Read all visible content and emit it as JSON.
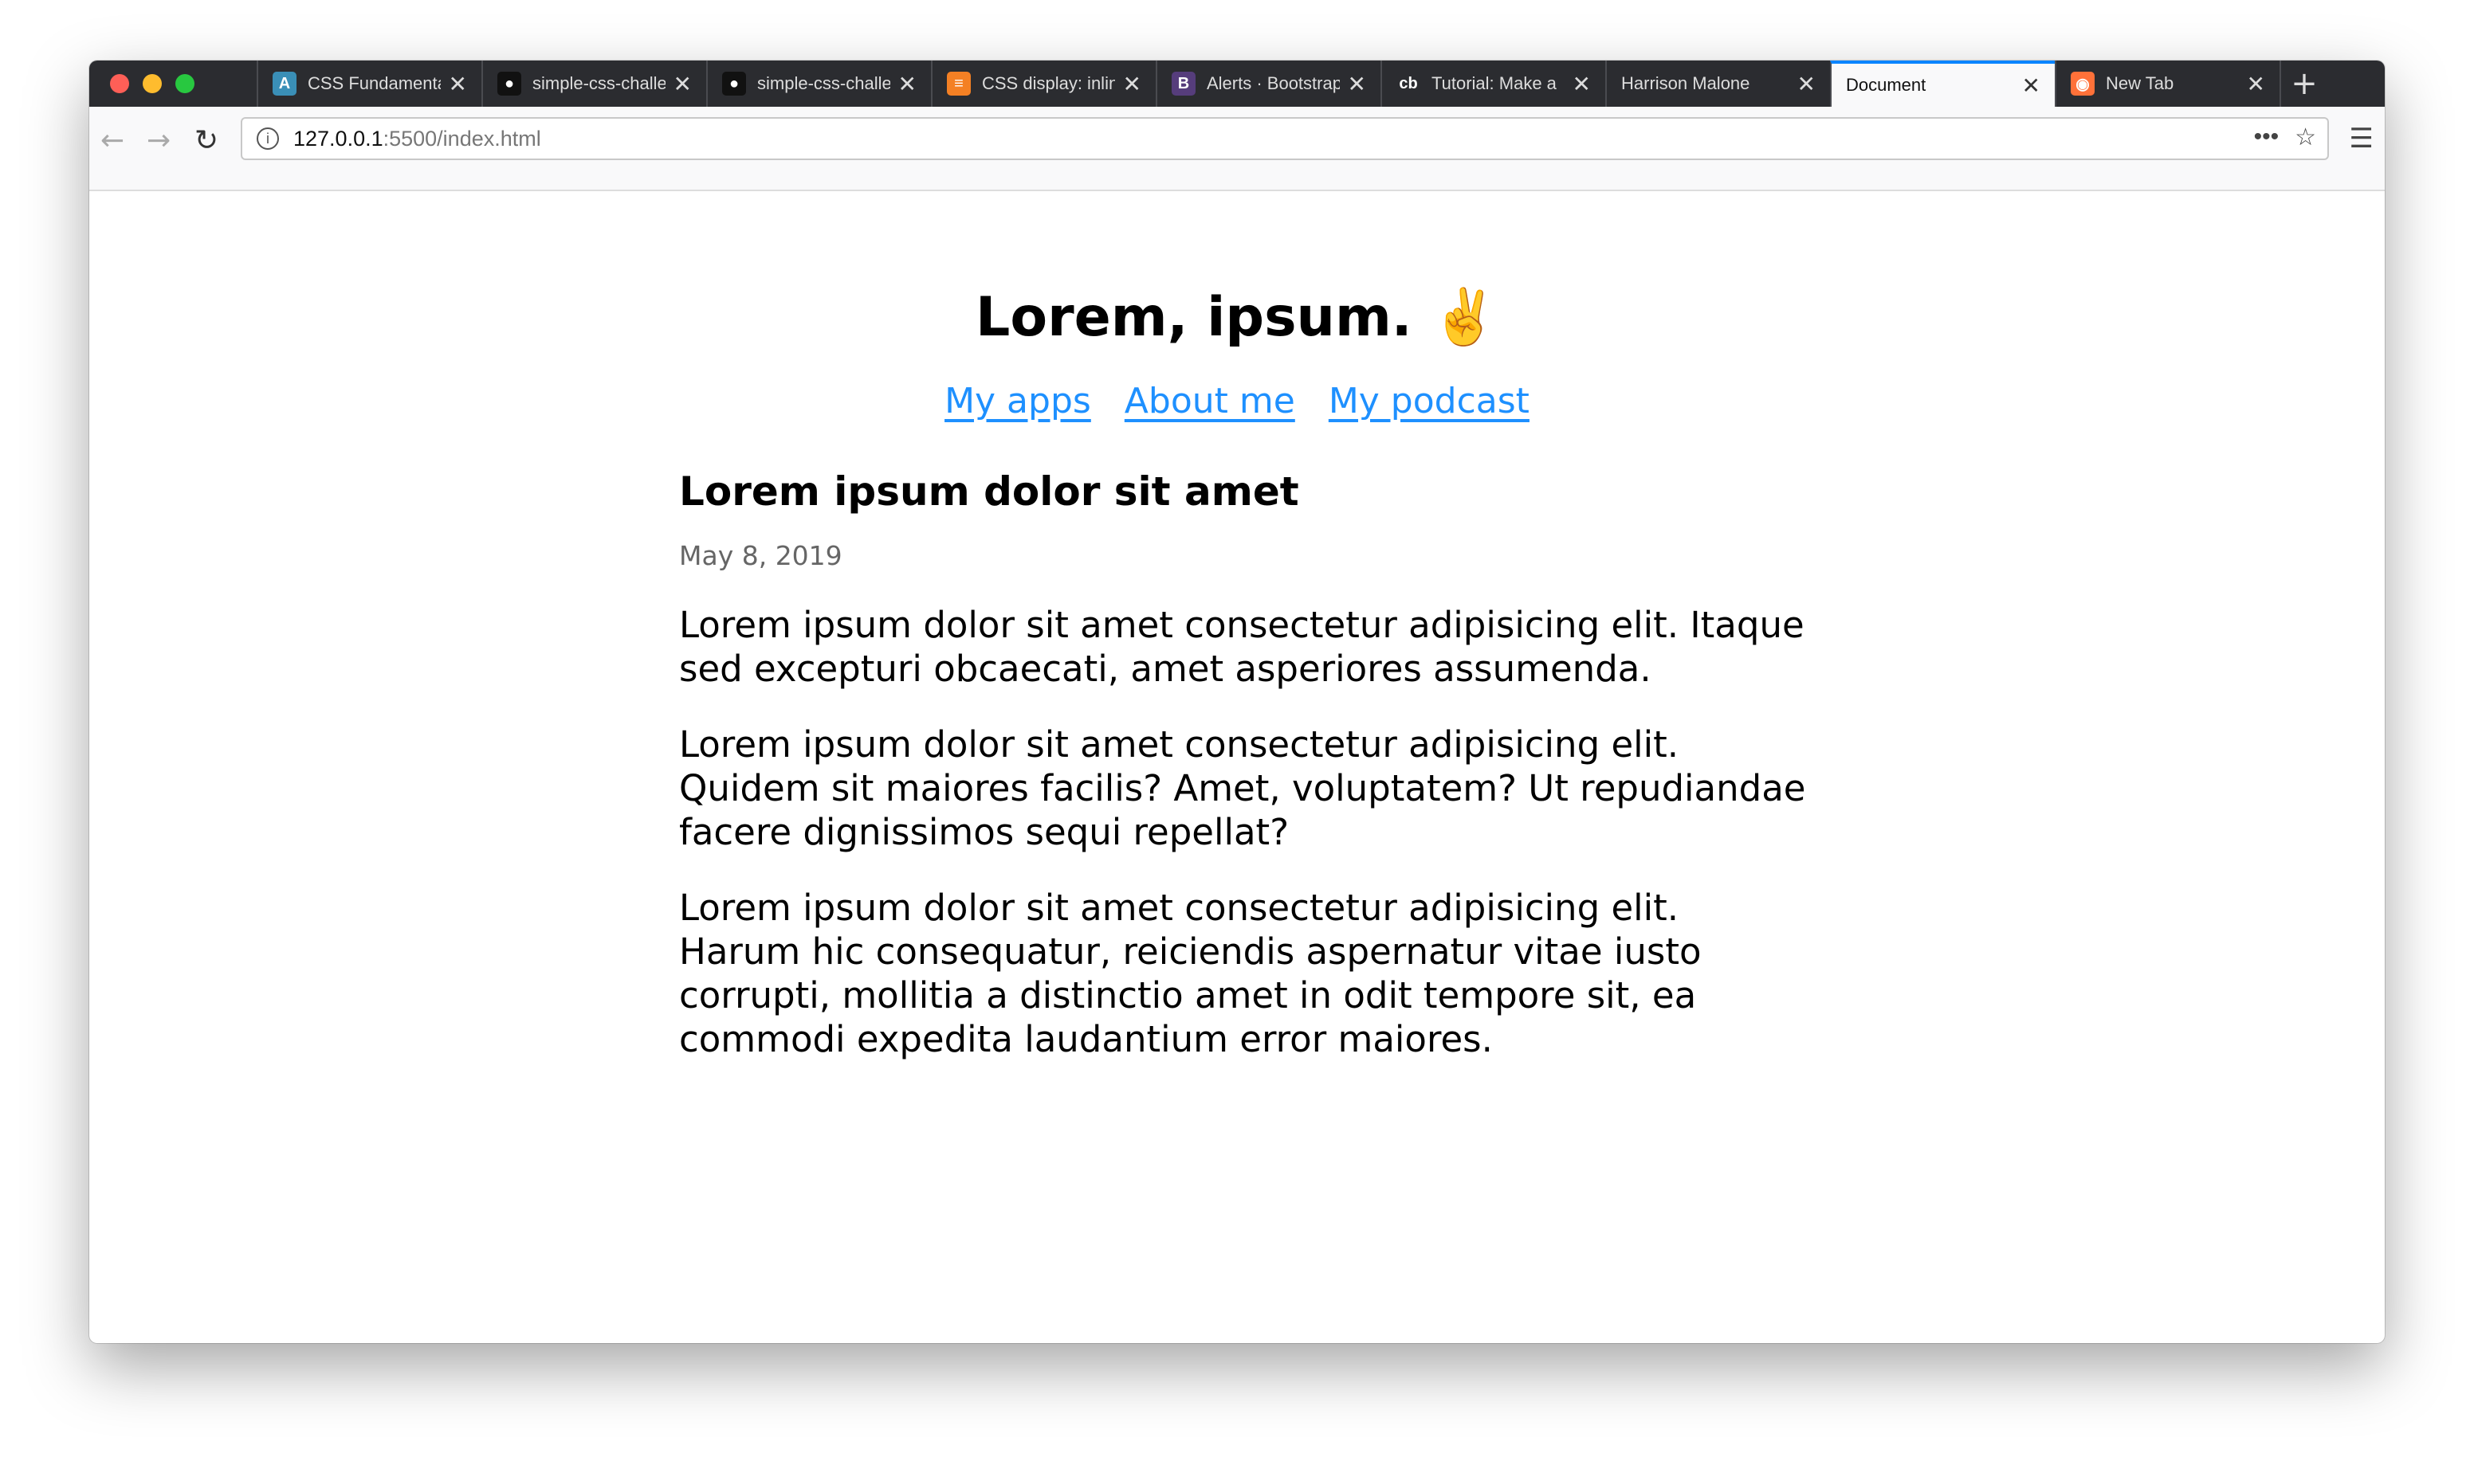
{
  "browser": {
    "tabs": [
      {
        "title": "CSS Fundamentals",
        "icon": "codecademy-icon",
        "color": "#3a8fb7",
        "glyph": "A"
      },
      {
        "title": "simple-css-challenge",
        "icon": "github-icon",
        "color": "#111111",
        "glyph": "●"
      },
      {
        "title": "simple-css-challenge",
        "icon": "github-icon",
        "color": "#111111",
        "glyph": "●"
      },
      {
        "title": "CSS display: inline",
        "icon": "stackoverflow-icon",
        "color": "#f48024",
        "glyph": "≡"
      },
      {
        "title": "Alerts · Bootstrap",
        "icon": "bootstrap-icon",
        "color": "#563d7c",
        "glyph": "B"
      },
      {
        "title": "Tutorial: Make a",
        "icon": "codebar-icon",
        "color": "#2b2c30",
        "glyph": "cb"
      },
      {
        "title": "Harrison Malone",
        "icon": "",
        "color": "",
        "glyph": ""
      },
      {
        "title": "Document",
        "icon": "",
        "color": "",
        "glyph": "",
        "active": true
      },
      {
        "title": "New Tab",
        "icon": "firefox-icon",
        "color": "#ff7139",
        "glyph": "◉"
      }
    ],
    "url_host": "127.0.0.1",
    "url_rest": ":5500/index.html"
  },
  "page": {
    "title": "Lorem, ipsum. ✌️",
    "nav": [
      "My apps",
      "About me",
      "My podcast"
    ],
    "article": {
      "heading": "Lorem ipsum dolor sit amet",
      "date": "May 8, 2019",
      "paragraphs": [
        "Lorem ipsum dolor sit amet consectetur adipisicing elit. Itaque sed excepturi obcaecati, amet asperiores assumenda.",
        "Lorem ipsum dolor sit amet consectetur adipisicing elit. Quidem sit maiores facilis? Amet, voluptatem? Ut repudiandae facere dignissimos sequi repellat?",
        "Lorem ipsum dolor sit amet consectetur adipisicing elit. Harum hic consequatur, reiciendis aspernatur vitae iusto corrupti, mollitia a distinctio amet in odit tempore sit, ea commodi expedita laudantium error maiores."
      ]
    },
    "link_color": "#1e90ff"
  }
}
